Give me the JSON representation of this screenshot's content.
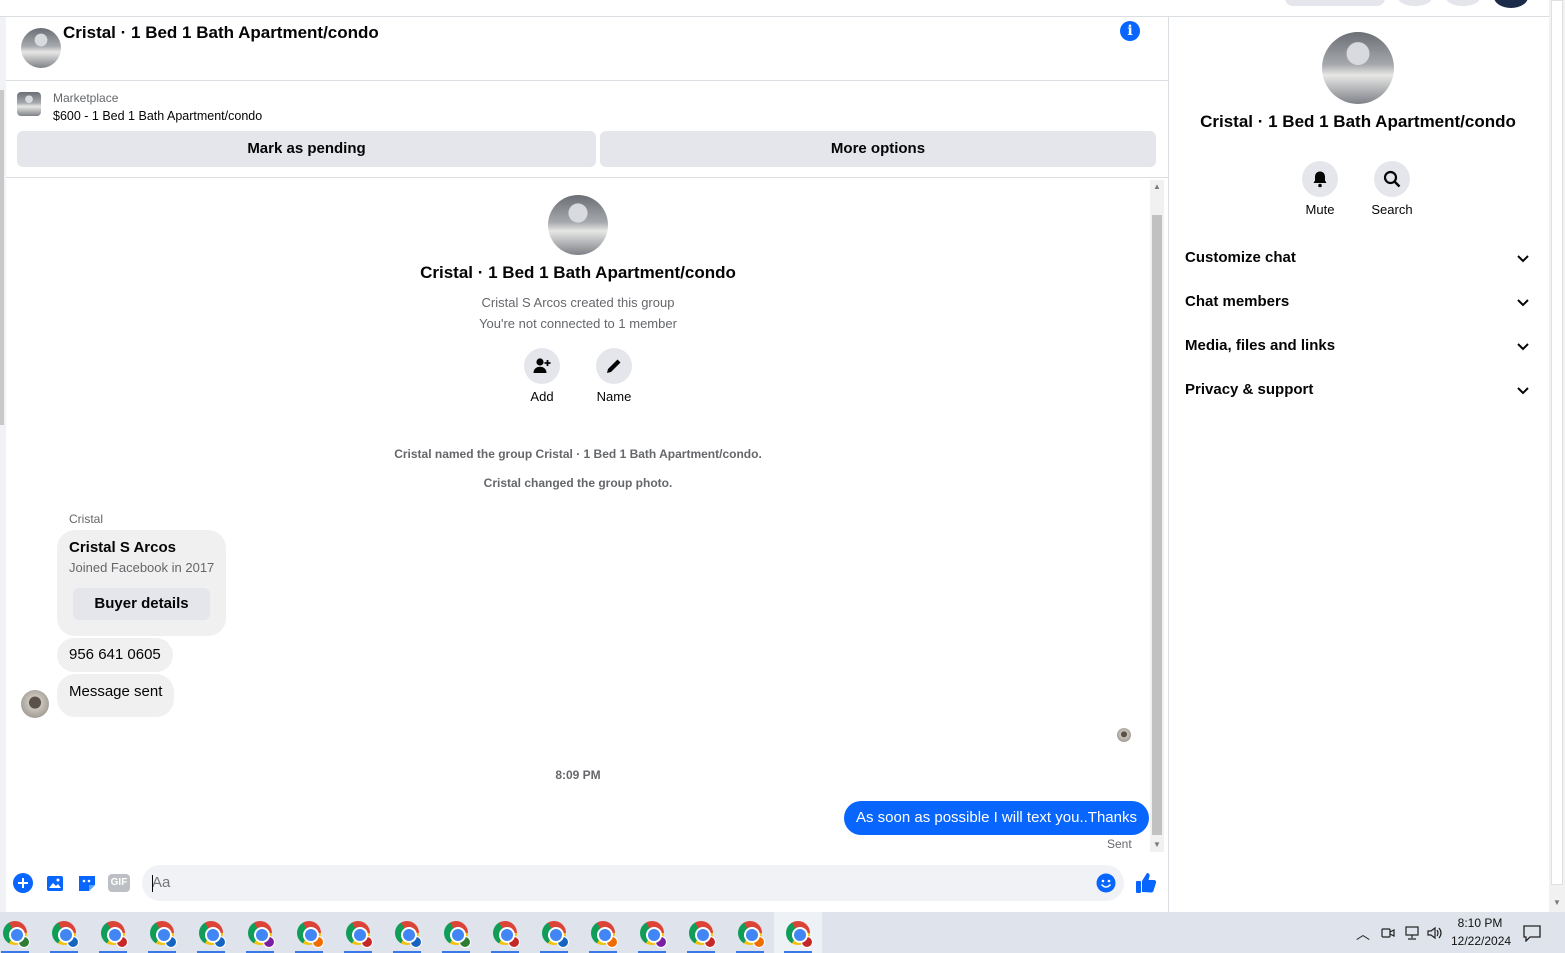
{
  "header": {
    "title": "Cristal · 1 Bed 1 Bath Apartment/condo"
  },
  "marketplace": {
    "label": "Marketplace",
    "listing": "$600 - 1 Bed 1 Bath Apartment/condo",
    "mark_pending_label": "Mark as pending",
    "more_options_label": "More options"
  },
  "intro": {
    "title": "Cristal · 1 Bed 1 Bath Apartment/condo",
    "creator_line": "Cristal S Arcos created this group",
    "connection_line": "You're not connected to 1 member",
    "add_label": "Add",
    "name_label": "Name"
  },
  "system_messages": [
    "Cristal named the group Cristal · 1 Bed 1 Bath Apartment/condo.",
    "Cristal changed the group photo."
  ],
  "messages": {
    "sender": "Cristal",
    "card": {
      "name": "Cristal S Arcos",
      "joined": "Joined Facebook in 2017",
      "buyer_button": "Buyer details"
    },
    "phone": "956 641 0605",
    "message_sent": "Message sent",
    "time_separator": "8:09 PM",
    "outgoing": "As soon as possible I will text you..Thanks",
    "status": "Sent"
  },
  "composer": {
    "placeholder": "Aa",
    "gif_label": "GIF"
  },
  "right_panel": {
    "title": "Cristal · 1 Bed 1 Bath Apartment/condo",
    "mute_label": "Mute",
    "search_label": "Search",
    "sections": [
      "Customize chat",
      "Chat members",
      "Media, files and links",
      "Privacy & support"
    ]
  },
  "taskbar": {
    "time": "8:10 PM",
    "date": "12/22/2024",
    "profile_colors": [
      "#2e7d32",
      "#1565c0",
      "#c62828",
      "#1565c0",
      "#1565c0",
      "#7b1fa2",
      "#ef6c00",
      "#c62828",
      "#1565c0",
      "#2e7d32",
      "#c62828",
      "#1565c0",
      "#ef6c00",
      "#7b1fa2",
      "#c62828",
      "#ef6c00",
      "#c62828"
    ]
  },
  "colors": {
    "accent": "#0866ff",
    "bubble_in": "#f0f0f0",
    "button_bg": "#e4e6eb"
  }
}
